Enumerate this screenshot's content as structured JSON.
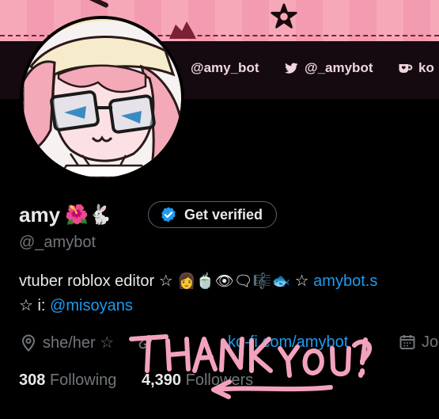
{
  "banner": {
    "socials": [
      {
        "icon": "at-handle",
        "label": "@amy_bot"
      },
      {
        "icon": "twitter-bird-icon",
        "label": "@_amybot"
      },
      {
        "icon": "kofi-cup-icon",
        "label": "ko"
      }
    ]
  },
  "profile": {
    "display_name": "amy",
    "name_emoji": "🌺🐇",
    "verify_label": "Get verified",
    "handle": "@_amybot",
    "bio": {
      "line1_text": "vtuber roblox editor ☆ ",
      "line1_emoji": "👩🍵👁🗨🎼🐟",
      "line1_sep": " ☆ ",
      "line1_link": "amybot.s",
      "line2_text": "☆ i: ",
      "line2_link": "@misoyans"
    },
    "meta": {
      "location": "she/her ☆",
      "website": "ko-fi.com/amybot",
      "joined": "Jo"
    },
    "following_count": "308",
    "following_label": "Following",
    "followers_count": "4,390",
    "followers_label": "Followers"
  },
  "annotation": {
    "text": "THANK YOU?!",
    "color": "#f3a2bd"
  },
  "colors": {
    "background": "#000000",
    "link": "#1d9bf0",
    "muted": "#71767b",
    "verified": "#1d9bf0",
    "banner_pink": "#f7a8b8"
  }
}
